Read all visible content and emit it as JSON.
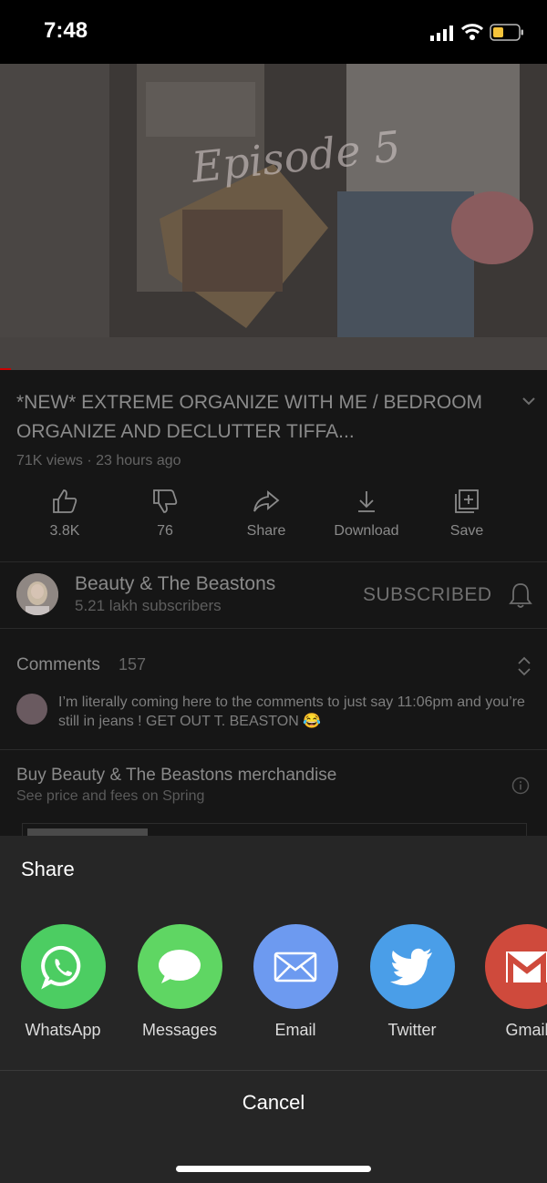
{
  "status": {
    "time": "7:48"
  },
  "video": {
    "overlay_text": "Episode 5"
  },
  "details": {
    "title": "*NEW* EXTREME ORGANIZE WITH ME / BEDROOM ORGANIZE AND DECLUTTER TIFFA...",
    "meta": "71K views · 23 hours ago",
    "actions": [
      {
        "icon": "thumbs-up-icon",
        "label": "3.8K"
      },
      {
        "icon": "thumbs-down-icon",
        "label": "76"
      },
      {
        "icon": "share-icon",
        "label": "Share"
      },
      {
        "icon": "download-icon",
        "label": "Download"
      },
      {
        "icon": "save-icon",
        "label": "Save"
      }
    ]
  },
  "channel": {
    "name": "Beauty & The Beastons",
    "subscribers": "5.21 lakh subscribers",
    "subscribe_label": "SUBSCRIBED"
  },
  "comments": {
    "heading": "Comments",
    "count": "157",
    "top_comment": "I’m literally coming here to the comments to just say 11:06pm and you’re still in jeans ! GET OUT T. BEASTON 😂"
  },
  "merch": {
    "heading": "Buy Beauty & The Beastons merchandise",
    "subheading": "See price and fees on Spring"
  },
  "share_sheet": {
    "title": "Share",
    "apps": [
      {
        "label": "WhatsApp",
        "icon": "whatsapp-icon",
        "color": "#4ccd62"
      },
      {
        "label": "Messages",
        "icon": "messages-icon",
        "color": "#5fd663"
      },
      {
        "label": "Email",
        "icon": "email-icon",
        "color": "#6d9af0"
      },
      {
        "label": "Twitter",
        "icon": "twitter-icon",
        "color": "#4a9ee8"
      },
      {
        "label": "Gmail",
        "icon": "gmail-icon",
        "color": "#cf4a3c"
      }
    ],
    "cancel_label": "Cancel"
  }
}
